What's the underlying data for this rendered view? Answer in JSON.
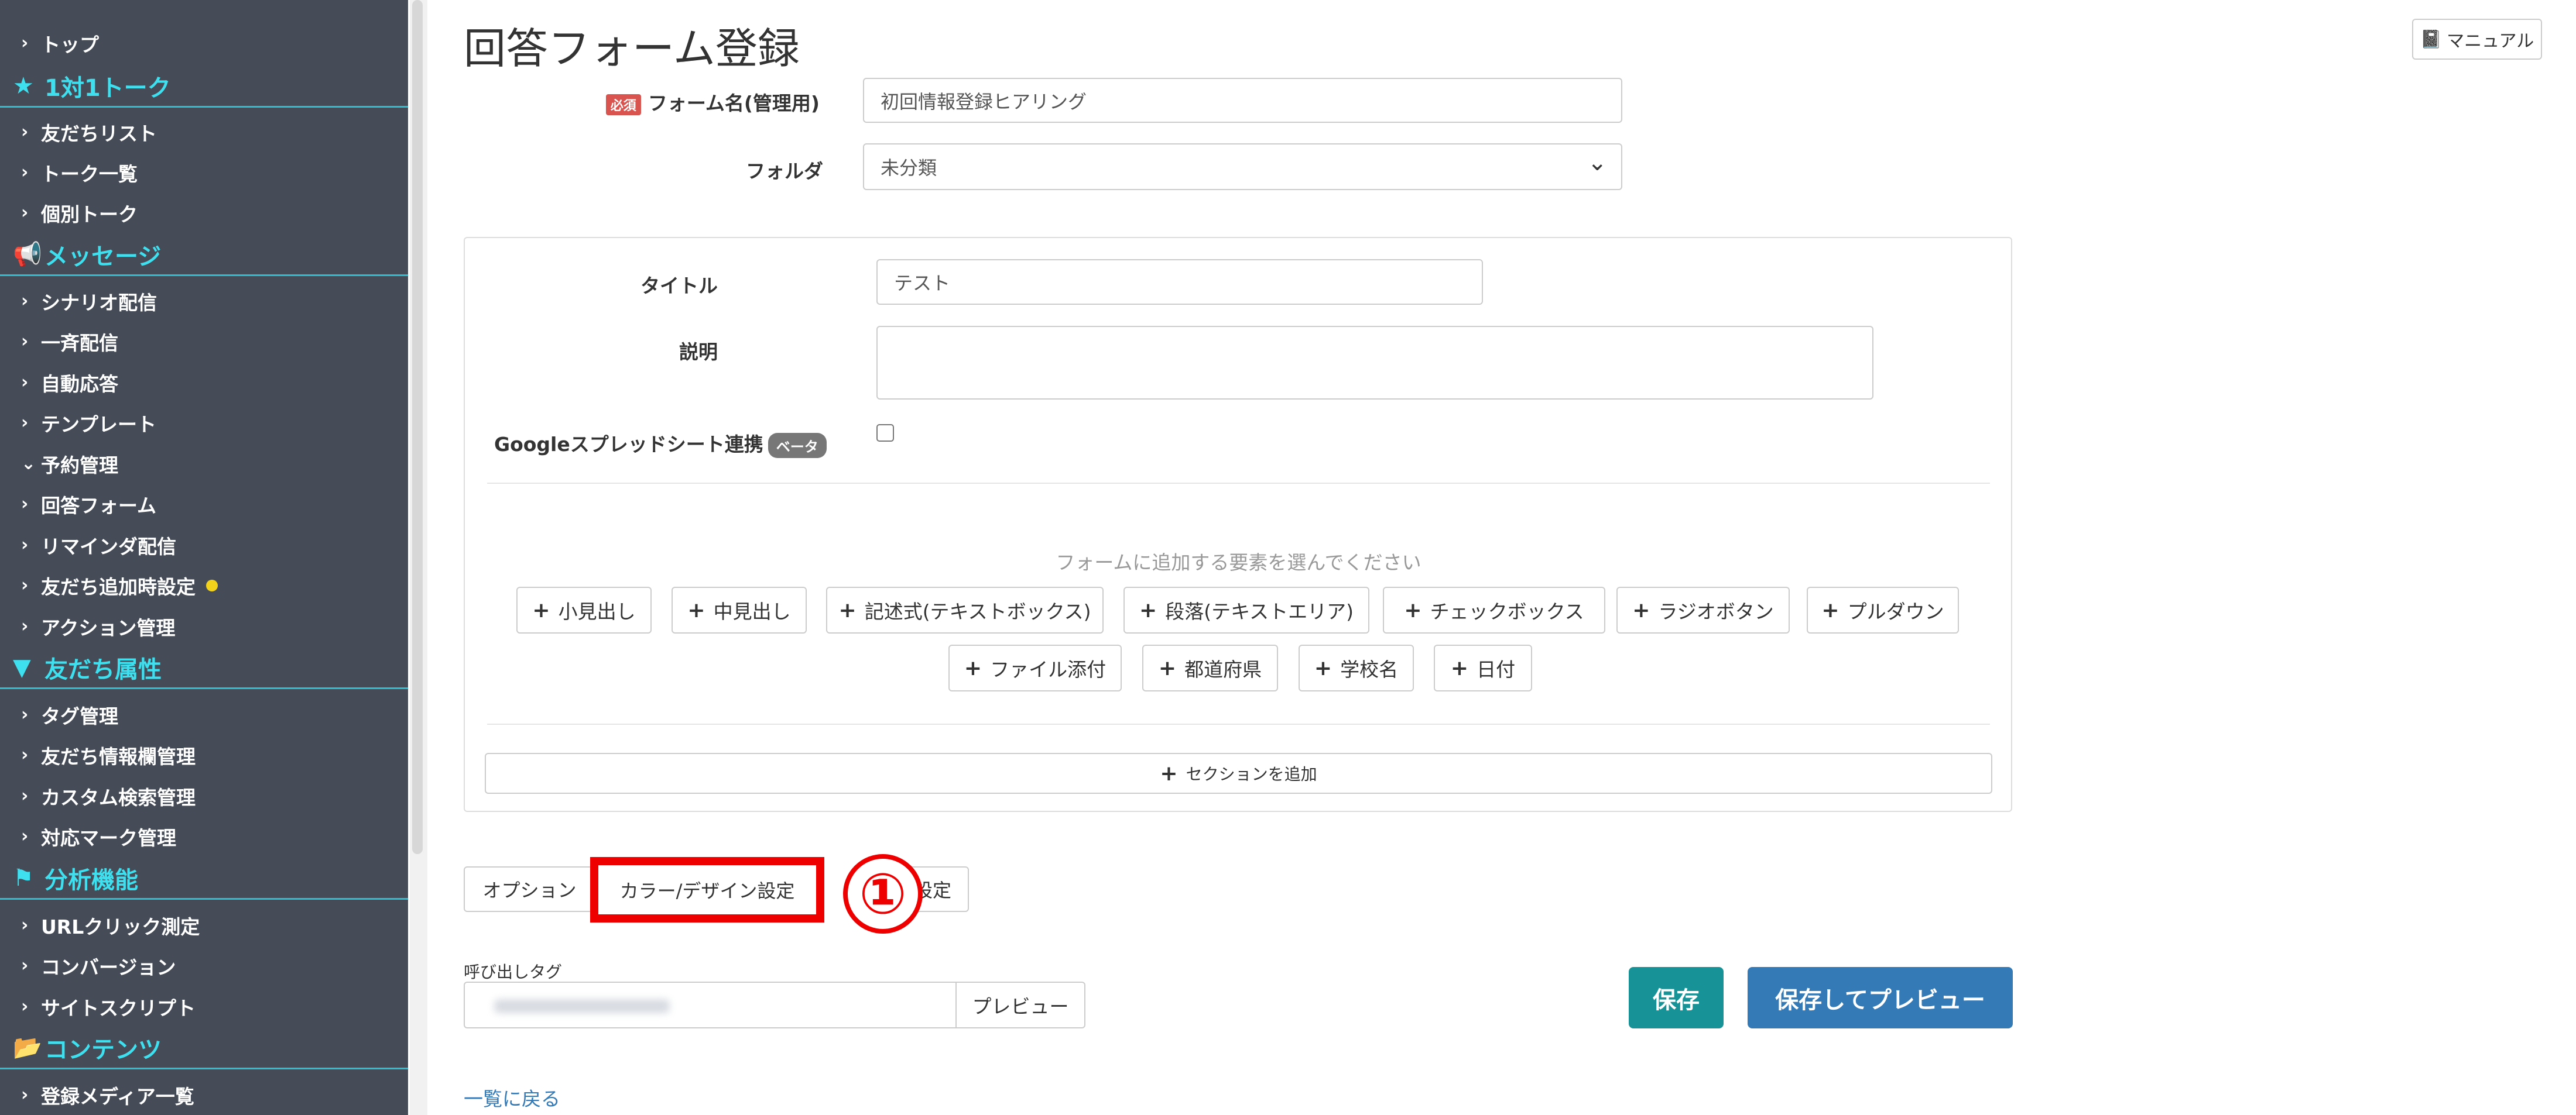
{
  "sidebar": {
    "top": "トップ",
    "sections": [
      {
        "heading": "1対1トーク",
        "icon": "star-icon",
        "items": [
          "友だちリスト",
          "トーク一覧",
          "個別トーク"
        ]
      },
      {
        "heading": "メッセージ",
        "icon": "megaphone-icon",
        "items": [
          "シナリオ配信",
          "一斉配信",
          "自動応答",
          "テンプレート",
          "予約管理",
          "回答フォーム",
          "リマインダ配信",
          "友だち追加時設定",
          "アクション管理"
        ]
      },
      {
        "heading": "友だち属性",
        "icon": "filter-icon",
        "items": [
          "タグ管理",
          "友だち情報欄管理",
          "カスタム検索管理",
          "対応マーク管理"
        ]
      },
      {
        "heading": "分析機能",
        "icon": "flag-icon",
        "items": [
          "URLクリック測定",
          "コンバージョン",
          "サイトスクリプト"
        ]
      },
      {
        "heading": "コンテンツ",
        "icon": "folder-icon",
        "items": [
          "登録メディア一覧"
        ]
      }
    ],
    "notify_color": "#f2d21b"
  },
  "header": {
    "title": "回答フォーム登録",
    "manual_label": "マニュアル"
  },
  "form": {
    "required_badge": "必須",
    "name_label": "フォーム名(管理用)",
    "name_value": "初回情報登録ヒアリング",
    "folder_label": "フォルダ",
    "folder_value": "未分類"
  },
  "panel": {
    "title_label": "タイトル",
    "title_value": "テスト",
    "desc_label": "説明",
    "desc_value": "",
    "sheets_label": "Googleスプレッドシート連携",
    "beta_badge": "ベータ",
    "sheets_checked": false,
    "elements_hint": "フォームに追加する要素を選んでください",
    "element_buttons_row1": [
      "小見出し",
      "中見出し",
      "記述式(テキストボックス)",
      "段落(テキストエリア)",
      "チェックボックス",
      "ラジオボタン",
      "プルダウン"
    ],
    "element_buttons_row2": [
      "ファイル添付",
      "都道府県",
      "学校名",
      "日付"
    ],
    "add_section_label": "セクションを追加"
  },
  "tabs": {
    "options": "オプション",
    "color_design": "カラー/デザイン設定",
    "third_partial": "設定"
  },
  "annotation": {
    "step_marker": "①",
    "highlight_color": "#ee0000"
  },
  "calltag": {
    "label": "呼び出しタグ",
    "preview_label": "プレビュー"
  },
  "actions": {
    "save": "保存",
    "save_preview": "保存してプレビュー",
    "back": "一覧に戻る"
  },
  "colors": {
    "sidebar_bg": "#454c57",
    "sidebar_accent": "#3ee0f0",
    "save": "#179397",
    "save_preview": "#337ab7",
    "link": "#337ab7"
  }
}
